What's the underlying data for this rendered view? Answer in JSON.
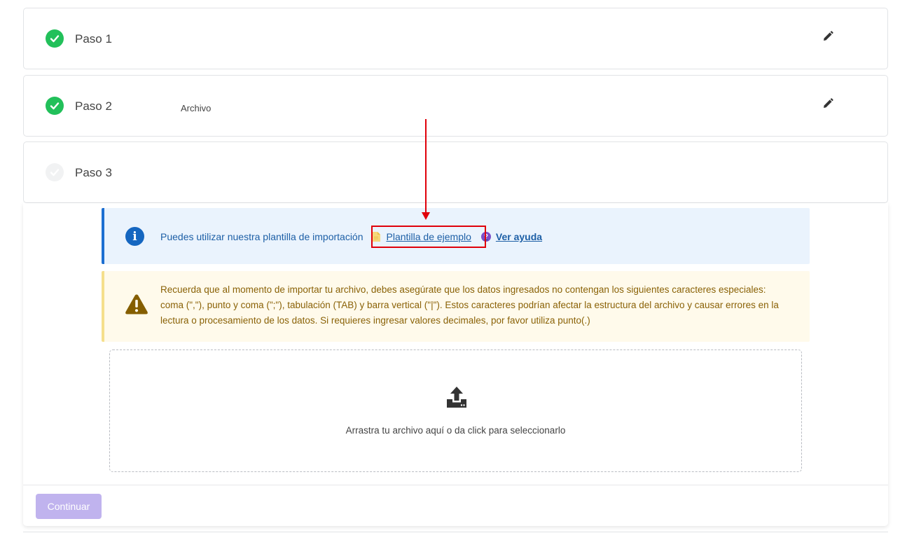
{
  "steps": [
    {
      "title": "Paso 1",
      "subtitle": "",
      "status": "done"
    },
    {
      "title": "Paso 2",
      "subtitle": "Archivo",
      "status": "done"
    },
    {
      "title": "Paso 3",
      "subtitle": "",
      "status": "pending"
    }
  ],
  "info": {
    "text": "Puedes utilizar nuestra plantilla de importación",
    "template_link": "Plantilla de ejemplo",
    "help_link": "Ver ayuda"
  },
  "warning": {
    "text": "Recuerda que al momento de importar tu archivo, debes asegúrate que los datos ingresados no contengan los siguientes caracteres especiales: coma (\",\"), punto y coma (\";\"), tabulación (TAB) y barra vertical (\"|\"). Estos caracteres podrían afectar la estructura del archivo y causar errores en la lectura o procesamiento de los datos. Si requieres ingresar valores decimales, por favor utiliza punto(.)"
  },
  "dropzone": {
    "text": "Arrastra tu archivo aquí o da click para seleccionarlo"
  },
  "footer": {
    "continue_label": "Continuar"
  },
  "colors": {
    "success": "#22c05a",
    "info_accent": "#1d6fd1",
    "warning_text": "#8a6207",
    "primary_disabled": "#c0b3ee",
    "annotation": "#e0000a"
  }
}
